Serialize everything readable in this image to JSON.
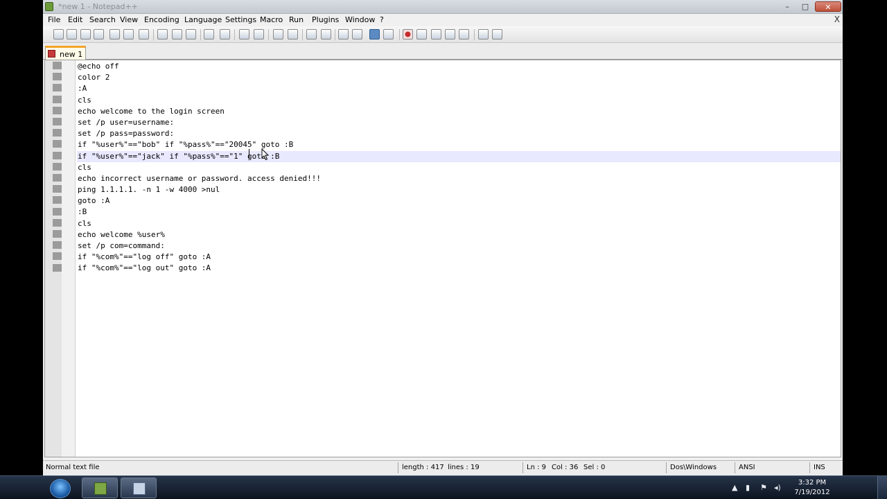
{
  "window": {
    "title": "*new  1 - Notepad++",
    "controls": {
      "minimize": "–",
      "maximize": "□",
      "close": "✕"
    }
  },
  "menu": {
    "items": [
      "File",
      "Edit",
      "Search",
      "View",
      "Encoding",
      "Language",
      "Settings",
      "Macro",
      "Run",
      "Plugins",
      "Window",
      "?"
    ],
    "close_doc": "X"
  },
  "tabs": [
    {
      "label": "new  1",
      "icon": "unsaved-file-icon"
    }
  ],
  "editor": {
    "lines": [
      "@echo off",
      "color 2",
      ":A",
      "cls",
      "echo welcome to the login screen",
      "set /p user=username:",
      "set /p pass=password:",
      "if \"%user%\"==\"bob\" if \"%pass%\"==\"20045\" goto :B",
      "if \"%user%\"==\"jack\" if \"%pass%\"==\"1\" goto :B",
      "cls",
      "echo incorrect username or password. access denied!!!",
      "ping 1.1.1.1. -n 1 -w 4000 >nul",
      "goto :A",
      ":B",
      "cls",
      "echo welcome %user%",
      "set /p com=command:",
      "if \"%com%\"==\"log off\" goto :A",
      "if \"%com%\"==\"log out\" goto :A"
    ],
    "current_line": 9
  },
  "statusbar": {
    "file_type": "Normal text file",
    "length": "length : 417",
    "lines": "lines : 19",
    "ln": "Ln : 9",
    "col": "Col : 36",
    "sel": "Sel : 0",
    "eol": "Dos\\Windows",
    "encoding": "ANSI",
    "mode": "INS"
  },
  "taskbar": {
    "clock_time": "3:32 PM",
    "clock_date": "7/19/2012",
    "tray": {
      "arrow": "▲",
      "network": "▮",
      "volume": "◂)"
    }
  },
  "colors": {
    "tab_accent": "#f4a52a",
    "current_line_bg": "#e8e8ff",
    "close_button": "#c0503a"
  }
}
